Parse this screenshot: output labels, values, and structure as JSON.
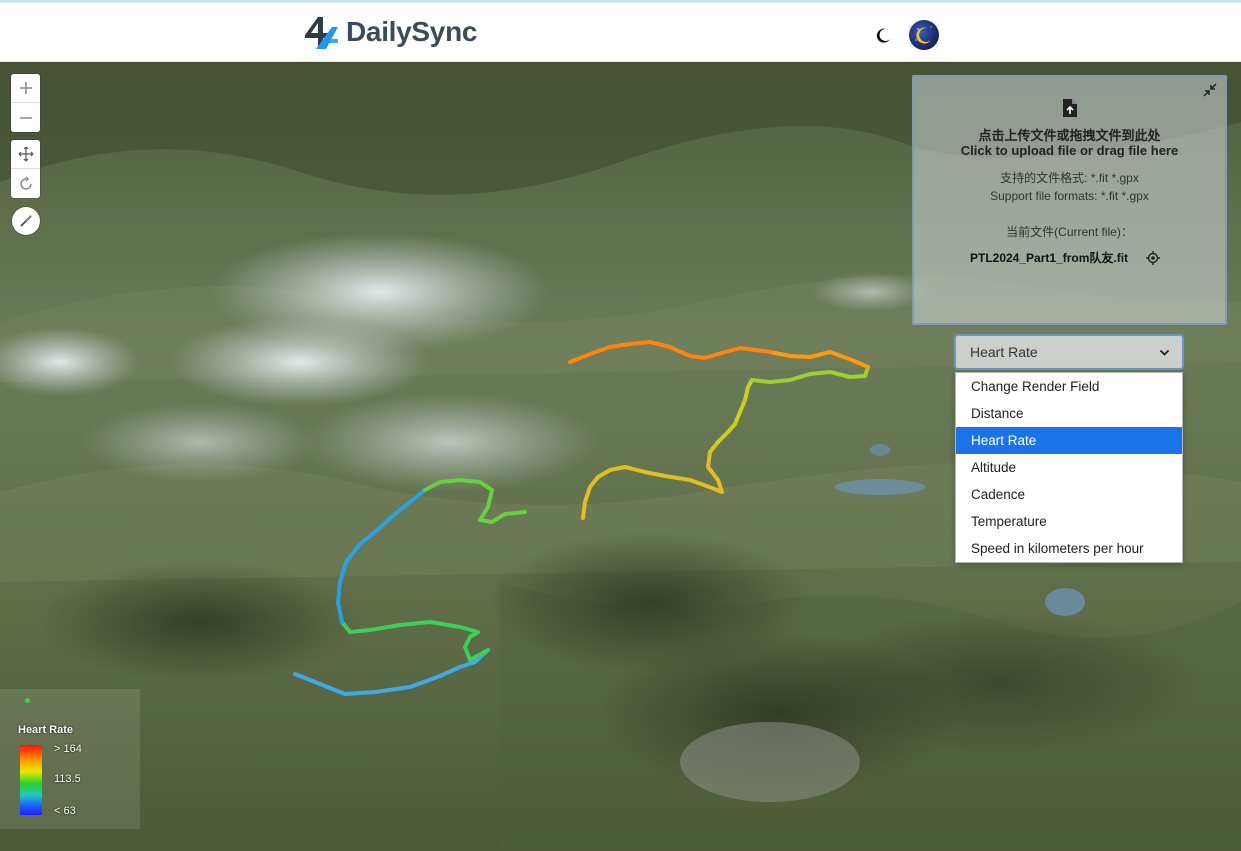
{
  "header": {
    "brand": "DailySync",
    "theme_icon": "moon-icon",
    "avatar_icon": "avatar-moon-icon"
  },
  "map_controls": {
    "zoom_in_icon": "plus-icon",
    "zoom_out_icon": "minus-icon",
    "pan_icon": "move-icon",
    "rotate_icon": "rotate-icon",
    "compass_icon": "compass-icon"
  },
  "upload_panel": {
    "upload_icon": "file-upload-icon",
    "upload_text_cn": "点击上传文件或拖拽文件到此处",
    "upload_text_en": "Click to upload file or drag file here",
    "formats_cn": "支持的文件格式: *.fit *.gpx",
    "formats_en": "Support file formats: *.fit *.gpx",
    "current_file_label": "当前文件(Current file)：",
    "current_file": "PTL2024_Part1_from队友.fit",
    "locate_icon": "target-icon",
    "collapse_icon": "collapse-icon"
  },
  "render_select": {
    "value": "Heart Rate",
    "options": [
      "Change Render Field",
      "Distance",
      "Heart Rate",
      "Altitude",
      "Cadence",
      "Temperature",
      "Speed in kilometers per hour"
    ],
    "selected_index": 2
  },
  "legend": {
    "title": "Heart Rate",
    "max_label": "> 164",
    "mid_label": "113.5",
    "min_label": "< 63"
  },
  "colors": {
    "brand_text": "#3b4a5c",
    "accent": "#1a73e8",
    "panel_border": "#7f9bb6"
  }
}
